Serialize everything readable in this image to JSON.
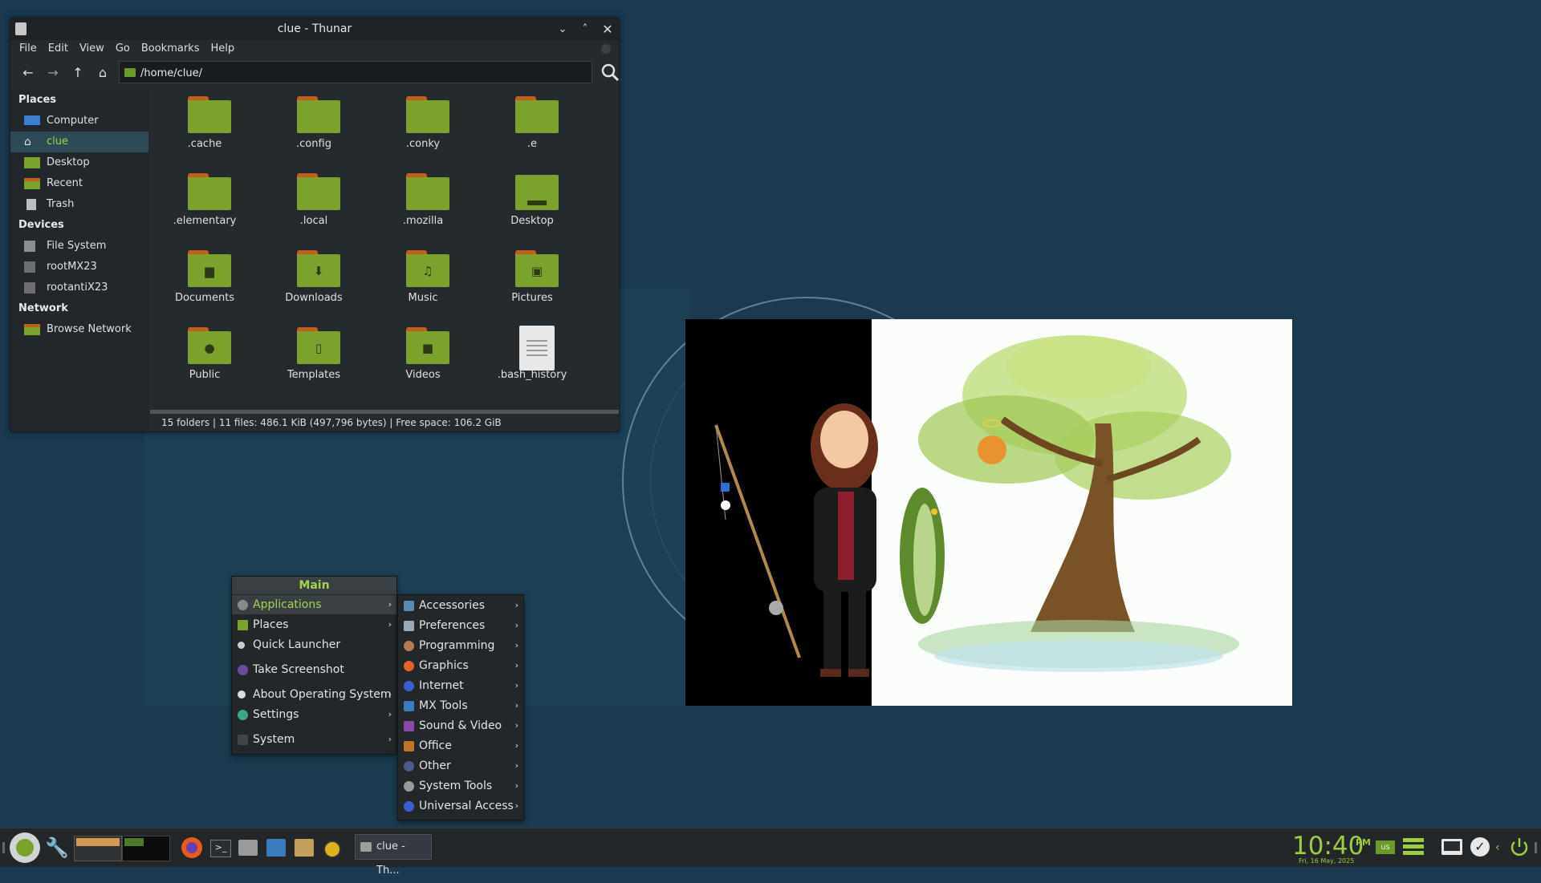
{
  "window": {
    "title": "clue - Thunar",
    "menu": [
      "File",
      "Edit",
      "View",
      "Go",
      "Bookmarks",
      "Help"
    ],
    "path": "/home/clue/",
    "sidebar": {
      "places_header": "Places",
      "places": [
        "Computer",
        "clue",
        "Desktop",
        "Recent",
        "Trash"
      ],
      "devices_header": "Devices",
      "devices": [
        "File System",
        "rootMX23",
        "rootantiX23"
      ],
      "network_header": "Network",
      "network": [
        "Browse Network"
      ]
    },
    "files": [
      ".cache",
      ".config",
      ".conky",
      ".e",
      ".elementary",
      ".local",
      ".mozilla",
      "Desktop",
      "Documents",
      "Downloads",
      "Music",
      "Pictures",
      "Public",
      "Templates",
      "Videos",
      ".bash_history"
    ],
    "status": "15 folders  |  11 files: 486.1 KiB (497,796 bytes)  |  Free space: 106.2 GiB"
  },
  "main_menu": {
    "header": "Main",
    "items": [
      "Applications",
      "Places",
      "Quick Launcher",
      "Take Screenshot",
      "About Operating System",
      "Settings",
      "System"
    ]
  },
  "apps_menu": {
    "items": [
      "Accessories",
      "Preferences",
      "Programming",
      "Graphics",
      "Internet",
      "MX Tools",
      "Sound & Video",
      "Office",
      "Other",
      "System Tools",
      "Universal Access"
    ]
  },
  "taskbar": {
    "task_label": "clue - Th...",
    "clock_time": "10:40",
    "clock_ampm": "PM",
    "clock_date": "Fri, 16 May, 2025",
    "keyboard_layout": "us"
  },
  "colors": {
    "accent": "#9ccd3f",
    "desktop": "#1b3a4f",
    "folder": "#7aa22c"
  }
}
